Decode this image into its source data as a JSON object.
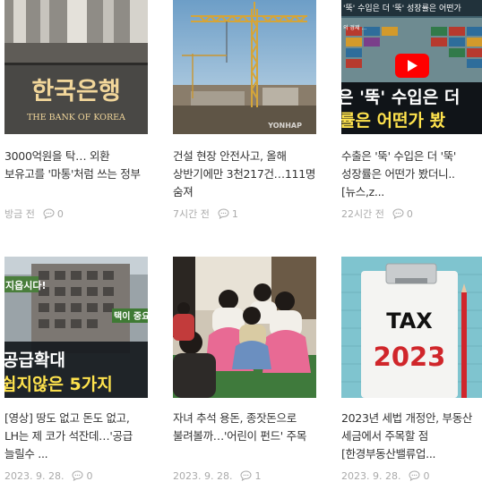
{
  "articles": [
    {
      "title": "3000억원을 탁… 외환 보유고를 '마통'처럼 쓰는 정부",
      "time": "방금 전",
      "comments": "0",
      "thumb": {
        "sign_text": "한국은행",
        "sign_sub": "THE BANK OF KOREA"
      }
    },
    {
      "title": "건설 현장 안전사고, 올해 상반기에만 3천217건…111명 숨져",
      "time": "7시간 전",
      "comments": "1",
      "thumb": {
        "watermark": "YONHAP"
      }
    },
    {
      "title": "수출은 '뚝' 수입은 더 '뚝' 성장률은 어떤가 봤더니.. [뉴스,z...",
      "time": "22시간 전",
      "comments": "0",
      "thumb": {
        "top_caption": "'뚝' 수입은 더 '뚝' 성장률은 어떤가",
        "mini_caption": "의 경제 ...",
        "line1": "은 '뚝' 수입은 더",
        "line2": "률은 어떤가 봤"
      }
    },
    {
      "title": "[영상] 땅도 없고 돈도 없고, LH는 제 코가 석잔데…'공급 늘릴수 ...",
      "time": "2023. 9. 28.",
      "comments": "0",
      "thumb": {
        "sign_left": "지읍시다!",
        "sign_right": "택이 중요",
        "line1": "공급확대",
        "line2": "쉽지않은 5가지"
      }
    },
    {
      "title": "자녀 추석 용돈, 종잣돈으로 불려볼까…'어린이 펀드' 주목",
      "time": "2023. 9. 28.",
      "comments": "1",
      "thumb": {}
    },
    {
      "title": "2023년 세법 개정안, 부동산 세금에서 주목할 점 [한경부동산밸류업...",
      "time": "2023. 9. 28.",
      "comments": "0",
      "thumb": {
        "word": "TAX",
        "year": "2023"
      }
    }
  ],
  "colors": {
    "title": "#333333",
    "meta": "#aaaaaa",
    "tax_red": "#d0262b",
    "youtube_red": "#ff0000"
  }
}
